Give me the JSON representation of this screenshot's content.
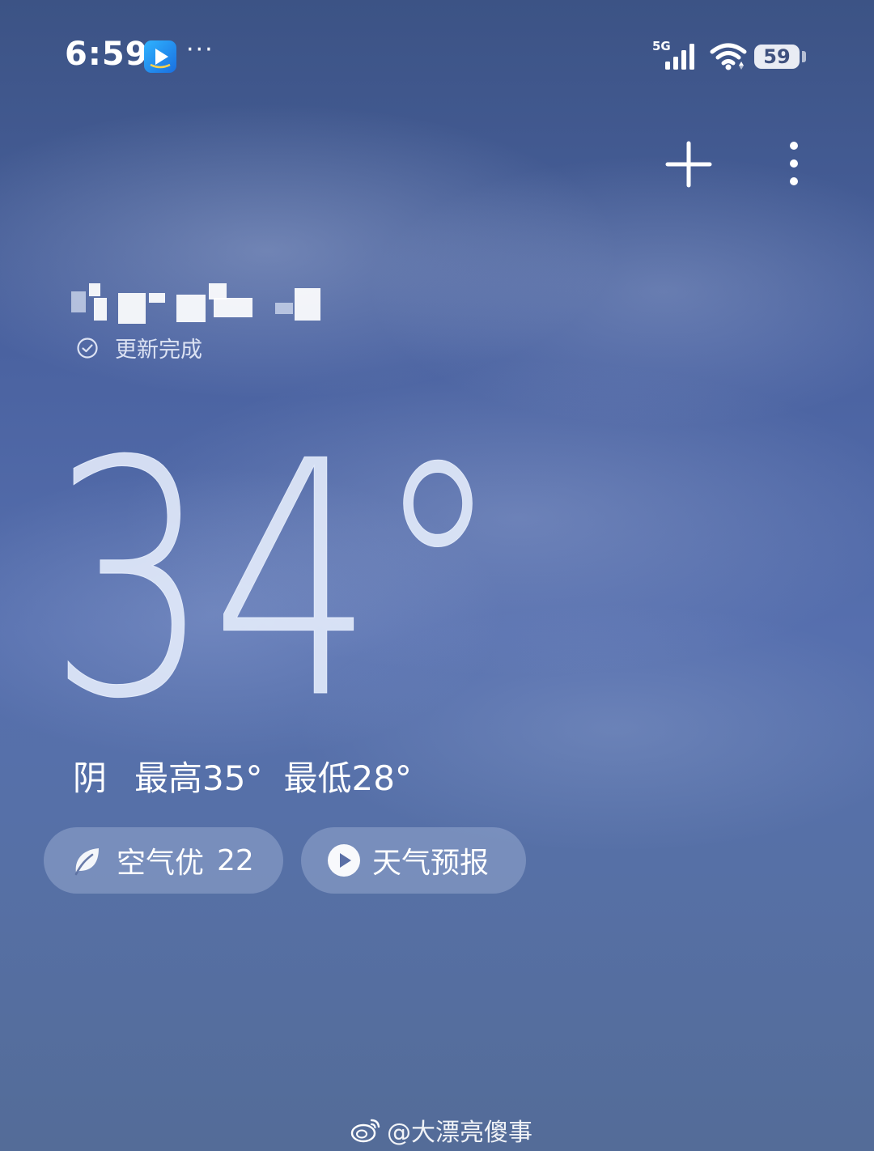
{
  "status_bar": {
    "time": "6:59",
    "more": "···",
    "network": "5G",
    "battery": "59"
  },
  "toolbar": {
    "add_icon": "plus-icon",
    "more_icon": "vertical-dots-icon"
  },
  "location": {
    "name_redacted": true,
    "update_status": "更新完成"
  },
  "weather": {
    "temperature": "34°",
    "condition": "阴",
    "high": "最高35°",
    "low": "最低28°"
  },
  "pills": {
    "air_quality_label": "空气优",
    "air_quality_value": "22",
    "forecast_label": "天气预报"
  },
  "watermark": {
    "text": "@大漂亮傻事"
  },
  "colors": {
    "background_top": "#3c5385",
    "background_bottom": "#546c98",
    "pill_background": "rgba(200,212,240,0.30)",
    "text": "#ffffff"
  }
}
